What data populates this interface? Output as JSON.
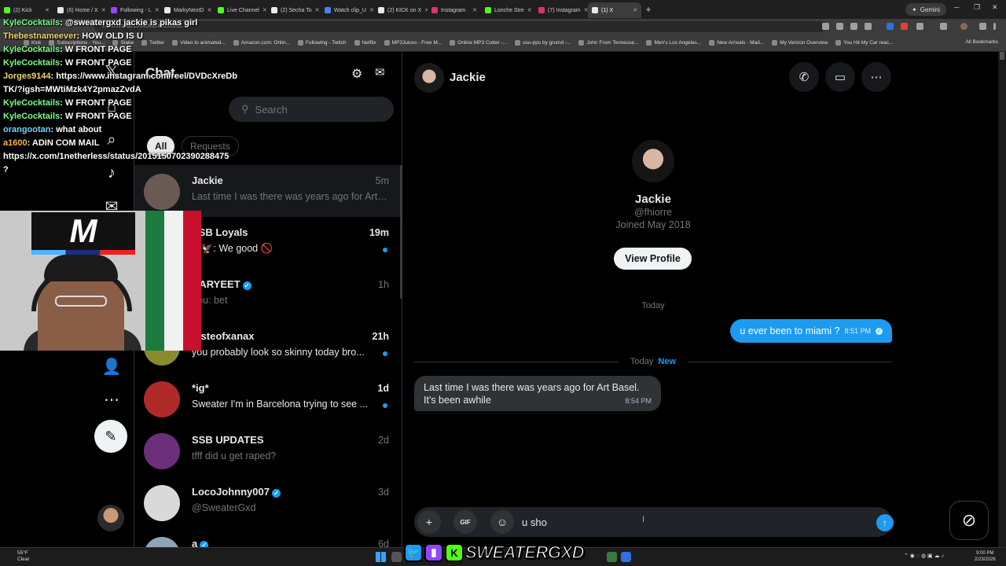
{
  "browser": {
    "tabs": [
      {
        "label": "(2) Kick",
        "color": "#53fc18",
        "active": false
      },
      {
        "label": "(6) Home / X",
        "color": "#e7e9ea",
        "active": false
      },
      {
        "label": "Following - L",
        "color": "#9146ff",
        "active": false
      },
      {
        "label": "MarkyNextD",
        "color": "#e7e9ea",
        "active": false
      },
      {
        "label": "Live Channel",
        "color": "#53fc18",
        "active": false
      },
      {
        "label": "(2) Secha To",
        "color": "#e7e9ea",
        "active": false
      },
      {
        "label": "Watch clip_U",
        "color": "#4285f4",
        "active": false
      },
      {
        "label": "(2) KICK on X",
        "color": "#e7e9ea",
        "active": false
      },
      {
        "label": "Instagram",
        "color": "#e1306c",
        "active": false
      },
      {
        "label": "Lonche Stre",
        "color": "#53fc18",
        "active": false
      },
      {
        "label": "(7) Instagram",
        "color": "#e1306c",
        "active": false
      },
      {
        "label": "(1) X",
        "color": "#e7e9ea",
        "active": true
      }
    ],
    "gemini_label": "Gemini",
    "url": "x.com/i/chat/1564093248296960...",
    "bookmarks": [
      {
        "label": "Kick"
      },
      {
        "label": "Subscriptions - You..."
      },
      {
        "label": "Stake"
      },
      {
        "label": "Twitter"
      },
      {
        "label": "Video to animated..."
      },
      {
        "label": "Amazon.com: Onlin..."
      },
      {
        "label": "Following - Twitch"
      },
      {
        "label": "Netflix"
      },
      {
        "label": "MP3Juices - Free M..."
      },
      {
        "label": "Online MP3 Cutter -..."
      },
      {
        "label": "osu-pps by grumd -..."
      },
      {
        "label": "John From Tennesse..."
      },
      {
        "label": "Men's Los Angeles..."
      },
      {
        "label": "New Arrivals - Mad..."
      },
      {
        "label": "My Verizon Overview"
      },
      {
        "label": "You Hit My Car reac..."
      }
    ],
    "all_bookmarks": "All Bookmarks"
  },
  "stream_chat": [
    {
      "user": "KyleCocktails",
      "text": "@sweatergxd jackie is pikas girl",
      "ucls": "u"
    },
    {
      "user": "Thebestnameever",
      "text": "HOW OLD IS U",
      "ucls": "u2"
    },
    {
      "user": "KyleCocktails",
      "text": "W FRONT PAGE",
      "ucls": "u"
    },
    {
      "user": "KyleCocktails",
      "text": "W FRONT PAGE",
      "ucls": "u"
    },
    {
      "user": "Jorges9144",
      "text": "https://www.instagram.com/reel/DVDcXreDb",
      "ucls": "u2"
    },
    {
      "user": "",
      "text": "TK/?igsh=MWtiMzk4Y2pmazZvdA",
      "ucls": "u2"
    },
    {
      "user": "KyleCocktails",
      "text": "W FRONT PAGE",
      "ucls": "u"
    },
    {
      "user": "KyleCocktails",
      "text": "W FRONT PAGE",
      "ucls": "u"
    },
    {
      "user": "orangootan",
      "text": "what about",
      "ucls": "u3"
    },
    {
      "user": "a1600",
      "text": "ADIN COM MAIL",
      "ucls": "u4"
    },
    {
      "user": "",
      "text": "https://x.com/1netherless/status/2015150702390288475",
      "ucls": "u4"
    },
    {
      "user": "",
      "text": "?",
      "ucls": "u4"
    }
  ],
  "sidebar": {
    "chat_title": "Chat"
  },
  "conversations": {
    "search_placeholder": "Search",
    "filter_all": "All",
    "filter_requests": "Requests",
    "items": [
      {
        "name": "Jackie",
        "time": "5m",
        "preview": "Last time I was there was years ago for Art Basel. It's been awhile",
        "unread": false,
        "verified": false,
        "avatar": "#6b5a52"
      },
      {
        "name": "SSB Loyals",
        "time": "19m",
        "preview": "S 🦅: We good 🚫",
        "unread": true,
        "verified": false,
        "avatar": "#7a3b2e"
      },
      {
        "name": "KARYEET",
        "time": "1h",
        "preview": "You: bet",
        "unread": false,
        "verified": true,
        "avatar": "#555555"
      },
      {
        "name": "tasteofxanax",
        "time": "21h",
        "preview": "you probably look so skinny today bro...",
        "unread": true,
        "verified": false,
        "avatar": "#8a8a2f"
      },
      {
        "name": "*ig*",
        "time": "1d",
        "preview": "Sweater I'm in Barcelona trying to see ...",
        "unread": true,
        "verified": false,
        "avatar": "#b02a2a"
      },
      {
        "name": "SSB UPDATES",
        "time": "2d",
        "preview": "tfff did u get raped?",
        "unread": false,
        "verified": false,
        "avatar": "#6b2e7a"
      },
      {
        "name": "LocoJohnny007",
        "time": "3d",
        "preview": "@SweaterGxd",
        "unread": false,
        "verified": true,
        "avatar": "#d9d9d9"
      },
      {
        "name": "a",
        "time": "6d",
        "preview": "",
        "unread": false,
        "verified": true,
        "avatar": "#8fa3b8"
      }
    ]
  },
  "chat": {
    "name": "Jackie",
    "handle": "@fhiorre",
    "joined": "Joined May 2018",
    "view_profile": "View Profile",
    "day_label_1": "Today",
    "outgoing": {
      "text": "u ever been to miami ?",
      "time": "8:51 PM"
    },
    "day_label_2": "Today",
    "new_label": "New",
    "incoming": {
      "line1": "Last time I was there was years ago for Art Basel.",
      "line2": "It's been awhile",
      "time": "8:54 PM"
    },
    "composer_value": "u sho"
  },
  "overlay": {
    "brand": "SWEATERGXD"
  },
  "taskbar": {
    "temp": "55°F",
    "weather": "Clear",
    "time": "9:00 PM",
    "date": "2/23/2026"
  }
}
